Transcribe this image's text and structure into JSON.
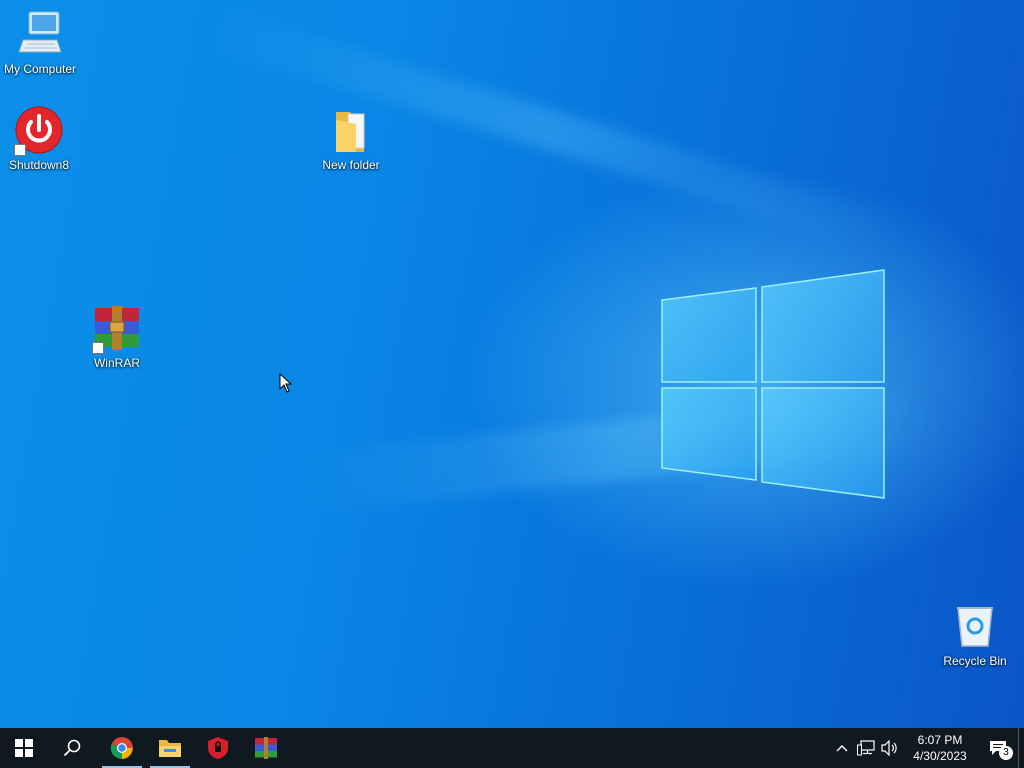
{
  "desktop": {
    "icons": [
      {
        "id": "my-computer",
        "label": "My Computer"
      },
      {
        "id": "shutdown8",
        "label": "Shutdown8"
      },
      {
        "id": "new-folder",
        "label": "New folder"
      },
      {
        "id": "winrar",
        "label": "WinRAR"
      },
      {
        "id": "recycle-bin",
        "label": "Recycle Bin"
      }
    ]
  },
  "taskbar": {
    "start_icon": "windows-start-icon",
    "search_icon": "search-icon",
    "pinned": [
      {
        "name": "chrome",
        "icon": "chrome-icon",
        "running": true
      },
      {
        "name": "file-explorer",
        "icon": "folder-icon",
        "running": true
      },
      {
        "name": "security-shield",
        "icon": "shield-icon",
        "running": false
      },
      {
        "name": "winrar",
        "icon": "winrar-icon",
        "running": false
      }
    ],
    "tray": {
      "time": "6:07 PM",
      "date": "4/30/2023",
      "notification_count": "3"
    }
  },
  "colors": {
    "taskbar": "#101820",
    "wallpaper_accent": "#0a86e6"
  }
}
